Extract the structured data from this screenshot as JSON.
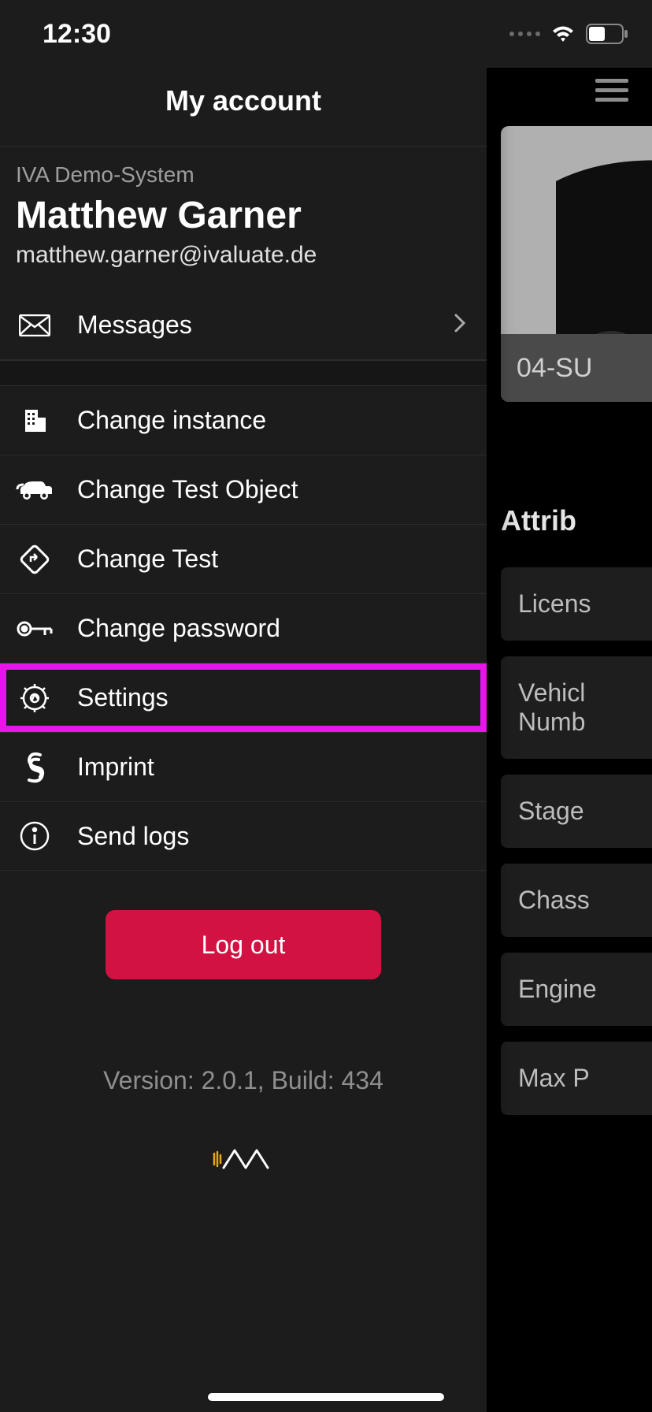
{
  "status": {
    "time": "12:30"
  },
  "drawer": {
    "title": "My account",
    "system": "IVA Demo-System",
    "name": "Matthew Garner",
    "email": "matthew.garner@ivaluate.de",
    "messages": "Messages",
    "items": [
      {
        "label": "Change instance"
      },
      {
        "label": "Change Test Object"
      },
      {
        "label": "Change Test"
      },
      {
        "label": "Change password"
      },
      {
        "label": "Settings"
      },
      {
        "label": "Imprint"
      },
      {
        "label": "Send logs"
      }
    ],
    "logout": "Log out",
    "version": "Version: 2.0.1, Build: 434"
  },
  "background": {
    "card_caption": "04-SU",
    "section_title": "Attrib",
    "attrs": [
      "Licens",
      "Vehicl\nNumb",
      "Stage",
      "Chass",
      "Engine",
      "Max P"
    ]
  }
}
